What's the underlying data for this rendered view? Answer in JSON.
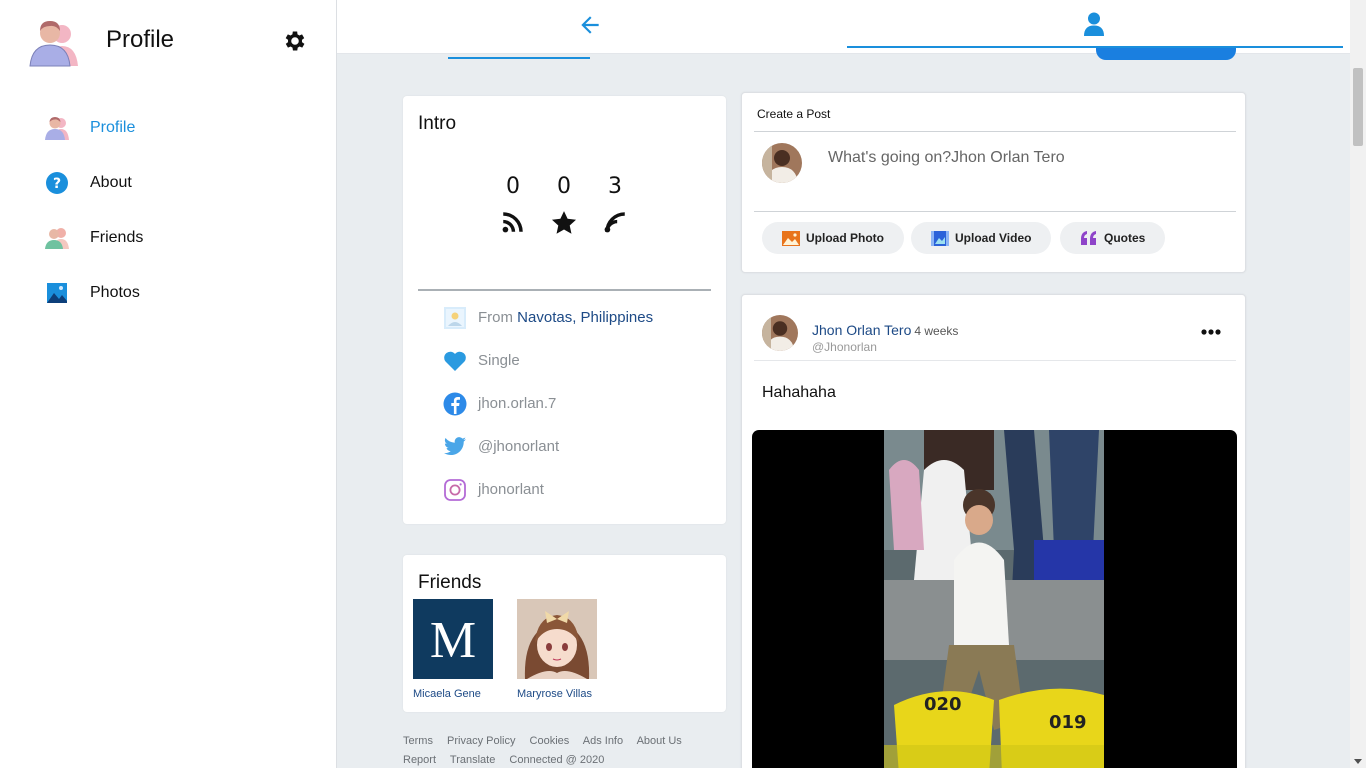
{
  "sidebar": {
    "title": "Profile",
    "items": [
      {
        "label": "Profile",
        "icon": "user-pair-icon",
        "active": true
      },
      {
        "label": "About",
        "icon": "question-icon",
        "active": false
      },
      {
        "label": "Friends",
        "icon": "friends-icon",
        "active": false
      },
      {
        "label": "Photos",
        "icon": "photos-icon",
        "active": false
      }
    ]
  },
  "topbar": {
    "back_icon": "arrow-left-icon",
    "profile_icon": "user-icon",
    "accent": "#1a8fdc"
  },
  "intro": {
    "heading": "Intro",
    "stats": [
      {
        "value": "0",
        "icon": "rss-icon"
      },
      {
        "value": "0",
        "icon": "star-icon"
      },
      {
        "value": "3",
        "icon": "follow-icon"
      }
    ],
    "from_label": "From",
    "city": "Navotas",
    "comma": ",",
    "country": "Philippines",
    "relationship": "Single",
    "facebook": "jhon.orlan.7",
    "twitter": "@jhonorlant",
    "instagram": "jhonorlant"
  },
  "friends": {
    "heading": "Friends",
    "list": [
      {
        "name": "Micaela Gene",
        "initial": "M",
        "color": "#0f3a5f"
      },
      {
        "name": "Maryrose Villas"
      }
    ]
  },
  "footer": {
    "links": [
      "Terms",
      "Privacy Policy",
      "Cookies",
      "Ads Info",
      "About Us",
      "Report",
      "Translate",
      "Connected @ 2020"
    ]
  },
  "create_post": {
    "title": "Create a Post",
    "placeholder": "What's going on?Jhon Orlan Tero",
    "actions": [
      {
        "label": "Upload Photo",
        "icon": "photo-icon"
      },
      {
        "label": "Upload Video",
        "icon": "video-icon"
      },
      {
        "label": "Quotes",
        "icon": "quote-icon"
      }
    ]
  },
  "post": {
    "author": "Jhon Orlan Tero",
    "time": "4 weeks",
    "handle": "@Jhonorlan",
    "text": "Hahahaha"
  }
}
